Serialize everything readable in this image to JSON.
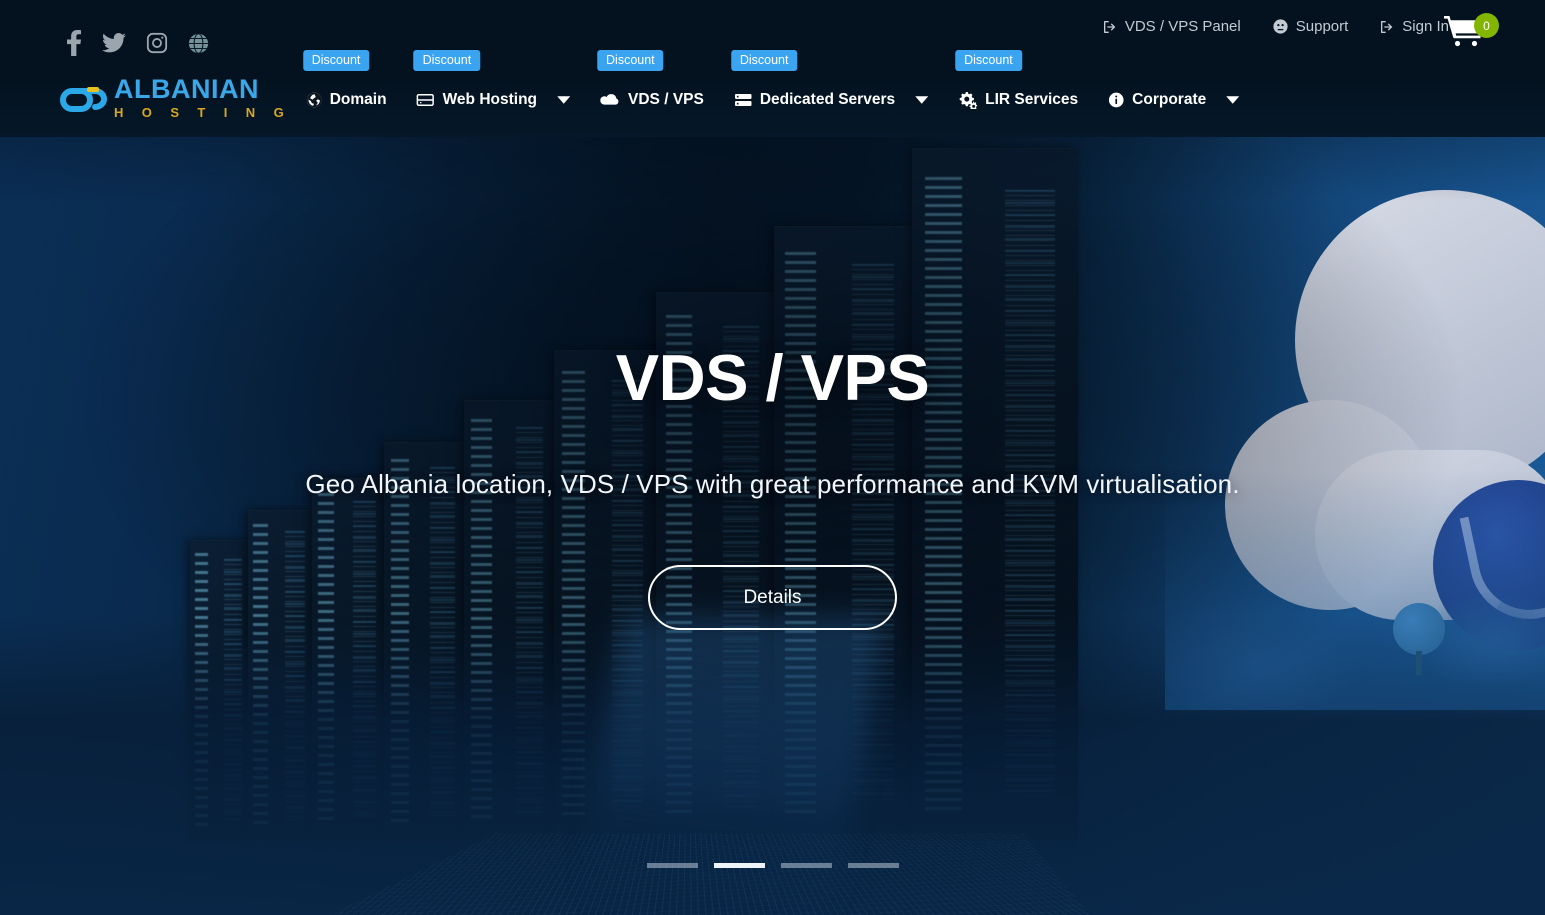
{
  "brand": {
    "logo_main": "ALBANIAN",
    "logo_sub": "H O S T I N G",
    "accent_blue": "#3aa8e8",
    "accent_gold": "#d8a820"
  },
  "social": [
    {
      "name": "facebook-icon",
      "label": "Facebook"
    },
    {
      "name": "twitter-icon",
      "label": "Twitter"
    },
    {
      "name": "instagram-icon",
      "label": "Instagram"
    },
    {
      "name": "language-globe-icon",
      "label": "Language"
    }
  ],
  "topnav": {
    "panel": "VDS / VPS Panel",
    "support": "Support",
    "signin": "Sign In",
    "cart_count": "0",
    "cart_badge_color": "#82b602"
  },
  "mainnav": {
    "discount_label": "Discount",
    "badge_color": "#3ba4f1",
    "items": [
      {
        "label": "Domain",
        "icon": "globe-icon",
        "has_discount": true,
        "has_caret": false
      },
      {
        "label": "Web Hosting",
        "icon": "server-box-icon",
        "has_discount": true,
        "has_caret": true
      },
      {
        "label": "VDS / VPS",
        "icon": "cloud-icon",
        "has_discount": true,
        "has_caret": false
      },
      {
        "label": "Dedicated Servers",
        "icon": "server-stack-icon",
        "has_discount": true,
        "has_caret": true
      },
      {
        "label": "LIR Services",
        "icon": "cogs-icon",
        "has_discount": true,
        "has_caret": false
      },
      {
        "label": "Corporate",
        "icon": "info-circle-icon",
        "has_discount": false,
        "has_caret": true
      }
    ]
  },
  "hero": {
    "title": "VDS / VPS",
    "subtitle": "Geo Albania location, VDS / VPS with great performance and KVM virtualisation.",
    "button_label": "Details"
  },
  "carousel": {
    "slide_count": 4,
    "active_index": 1
  }
}
